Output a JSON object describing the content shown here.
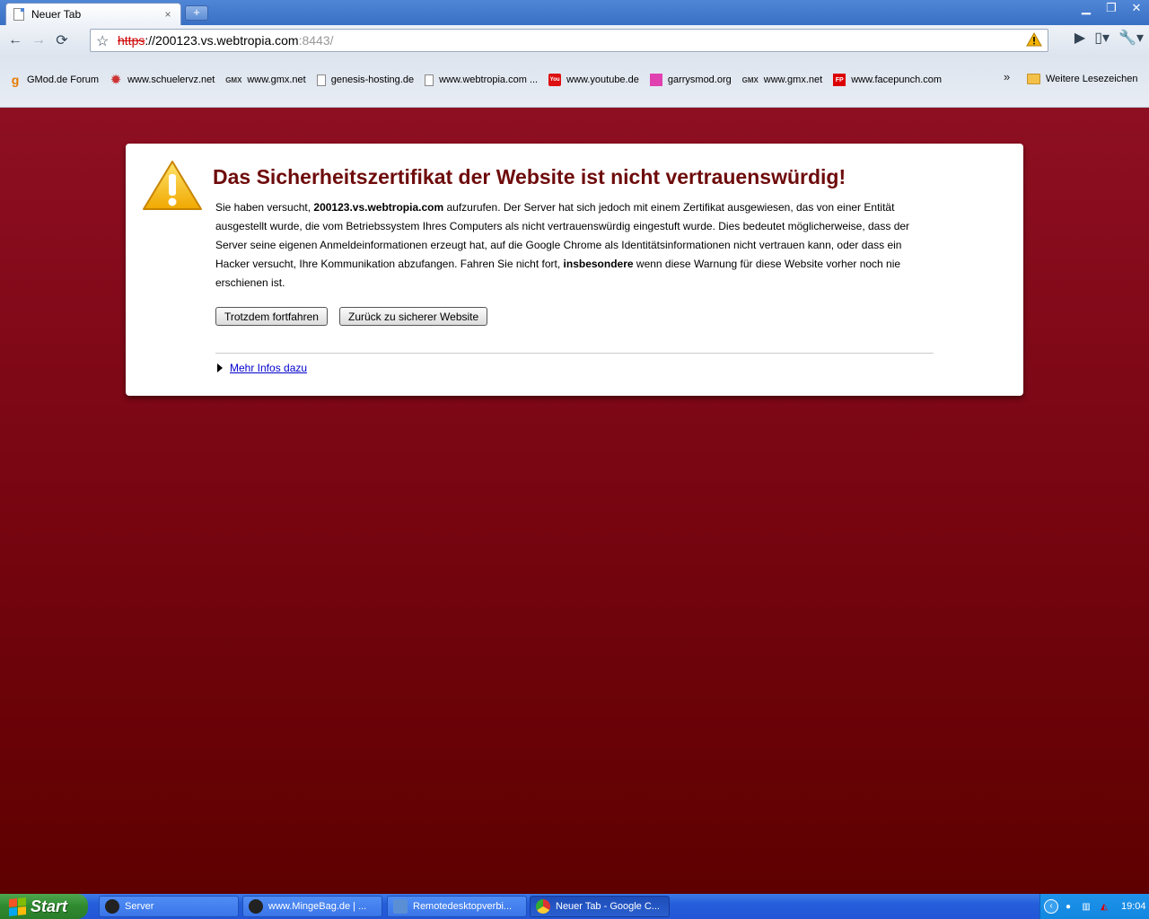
{
  "tab": {
    "title": "Neuer Tab",
    "close": "×",
    "new_tab": "+"
  },
  "window": {
    "minimize": "▁",
    "restore": "❐",
    "close": "✕"
  },
  "toolbar": {
    "back": "←",
    "forward": "→",
    "reload": "⟳",
    "star": "☆",
    "page_menu": "▯▾",
    "tools_menu": "🔧▾",
    "go": "▶"
  },
  "omnibox": {
    "scheme": "https",
    "host": "://200123.vs.webtropia.com",
    "port": ":8443/"
  },
  "bookmarks": [
    {
      "label": "GMod.de Forum",
      "icon": "gmod-icon",
      "glyph": "g"
    },
    {
      "label": "www.schuelervz.net",
      "icon": "schuelervz-icon",
      "glyph": "✹"
    },
    {
      "label": "www.gmx.net",
      "icon": "gmx-icon",
      "glyph": "GMX"
    },
    {
      "label": "genesis-hosting.de",
      "icon": "page-icon",
      "glyph": ""
    },
    {
      "label": "www.webtropia.com ...",
      "icon": "page-icon",
      "glyph": ""
    },
    {
      "label": "www.youtube.de",
      "icon": "youtube-icon",
      "glyph": "You"
    },
    {
      "label": "garrysmod.org",
      "icon": "garrysmod-icon",
      "glyph": ""
    },
    {
      "label": "www.gmx.net",
      "icon": "gmx-icon",
      "glyph": "GMX"
    },
    {
      "label": "www.facepunch.com",
      "icon": "facepunch-icon",
      "glyph": "FP"
    }
  ],
  "bookmarks_overflow": "»",
  "other_bookmarks": "Weitere Lesezeichen",
  "interstitial": {
    "heading": "Das Sicherheitszertifikat der Website ist nicht vertrauenswürdig!",
    "p1": "Sie haben versucht, ",
    "host_bold": "200123.vs.webtropia.com",
    "p2": " aufzurufen. Der Server hat sich jedoch mit einem Zertifikat ausgewiesen, das von einer Entität ausgestellt wurde, die vom Betriebssystem Ihres Computers als nicht vertrauenswürdig eingestuft wurde. Dies bedeutet möglicherweise, dass der Server seine eigenen Anmeldeinformationen erzeugt hat, auf die Google Chrome als Identitätsinformationen nicht vertrauen kann, oder dass ein Hacker versucht, Ihre Kommunikation abzufangen. Fahren Sie nicht fort, ",
    "emph_bold": "insbesondere",
    "p3": " wenn diese Warnung für diese Website vorher noch nie erschienen ist.",
    "proceed_button": "Trotzdem fortfahren",
    "back_button": "Zurück zu sicherer Website",
    "more_info": "Mehr Infos dazu"
  },
  "taskbar": {
    "start": "Start",
    "tasks": [
      {
        "label": "Server",
        "icon": "steam-icon",
        "active": false
      },
      {
        "label": "www.MingeBag.de | ...",
        "icon": "steam-icon",
        "active": false
      },
      {
        "label": "Remotedesktopverbi...",
        "icon": "remote-desktop-icon",
        "active": false
      },
      {
        "label": "Neuer Tab - Google C...",
        "icon": "chrome-icon",
        "active": true
      }
    ],
    "clock": "19:04"
  },
  "colors": {
    "heading": "#6e0b0b",
    "bg_top": "#8e0f22",
    "bg_bottom": "#5e0000",
    "link": "#0000cc"
  }
}
